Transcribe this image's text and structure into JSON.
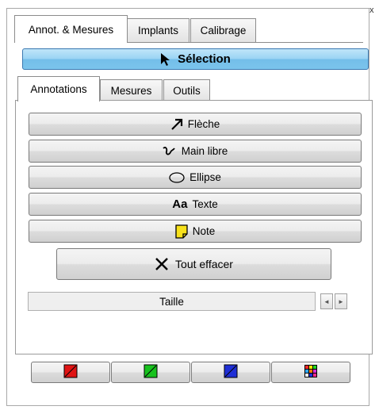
{
  "window": {
    "close_glyph": "x"
  },
  "top_tabs": [
    {
      "label": "Annot. & Mesures",
      "active": true
    },
    {
      "label": "Implants",
      "active": false
    },
    {
      "label": "Calibrage",
      "active": false
    }
  ],
  "selection": {
    "label": "Sélection",
    "icon": "cursor-arrow-icon",
    "color": "#9ad4f4"
  },
  "sub_tabs": [
    {
      "label": "Annotations",
      "active": true
    },
    {
      "label": "Mesures",
      "active": false
    },
    {
      "label": "Outils",
      "active": false
    }
  ],
  "tools": [
    {
      "label": "Flèche",
      "icon": "arrow-icon"
    },
    {
      "label": "Main libre",
      "icon": "freehand-icon"
    },
    {
      "label": "Ellipse",
      "icon": "ellipse-icon"
    },
    {
      "label": "Texte",
      "icon": "text-icon",
      "icon_text": "Aa"
    },
    {
      "label": "Note",
      "icon": "note-icon",
      "color": "#f7e11b"
    }
  ],
  "clear": {
    "label": "Tout effacer",
    "icon": "cross-icon"
  },
  "size": {
    "label": "Taille",
    "left_glyph": "◄",
    "right_glyph": "►"
  },
  "colors": [
    {
      "name": "red",
      "color": "#e01414"
    },
    {
      "name": "green",
      "color": "#18c21e"
    },
    {
      "name": "blue",
      "color": "#1f2fd6"
    },
    {
      "name": "multicolor",
      "icon": "palette-grid-icon"
    }
  ]
}
